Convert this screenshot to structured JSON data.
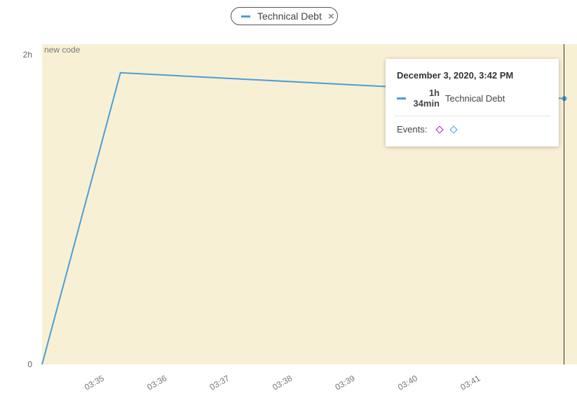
{
  "legend": {
    "label": "Technical Debt",
    "color": "#4b9fd5",
    "close_icon": "×"
  },
  "tooltip": {
    "date": "December 3, 2020, 3:42 PM",
    "value_line1": "1h",
    "value_line2": "34min",
    "metric": "Technical Debt",
    "events_label": "Events:",
    "event_colors": [
      "#9c27b0",
      "#4b9fd5"
    ]
  },
  "chart_data": {
    "type": "line",
    "band_label": "new code",
    "band_color": "#f8f0d5",
    "yticks": [
      "0",
      "2h"
    ],
    "ylim_minutes": [
      0,
      120
    ],
    "xticks": [
      "03:35",
      "03:36",
      "03:37",
      "03:38",
      "03:39",
      "03:40",
      "03:41"
    ],
    "xlim": [
      "03:34:00",
      "03:42:20"
    ],
    "series": [
      {
        "name": "Technical Debt",
        "color": "#4b9fd5",
        "points": [
          {
            "x": "03:34:00",
            "minutes": 0
          },
          {
            "x": "03:35:15",
            "minutes": 113
          },
          {
            "x": "03:40:00",
            "minutes": 107
          },
          {
            "x": "03:42:20",
            "minutes": 103
          }
        ]
      }
    ]
  }
}
